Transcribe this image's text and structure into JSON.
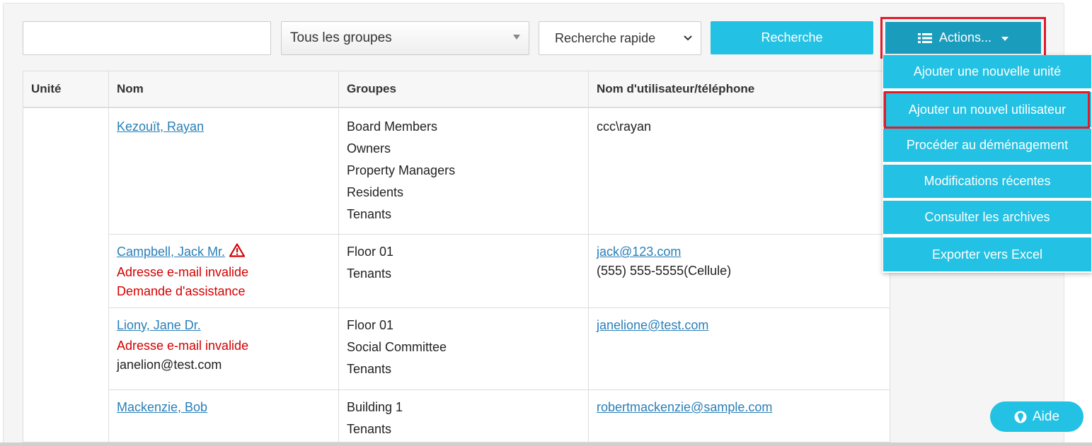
{
  "toolbar": {
    "search_value": "",
    "group_select": "Tous les groupes",
    "quick_select": "Recherche rapide",
    "search_button": "Recherche",
    "actions_button": "Actions..."
  },
  "actions_menu": {
    "items": [
      "Ajouter une nouvelle unité",
      "Ajouter un nouvel utilisateur",
      "Procéder au déménagement",
      "Modifications récentes",
      "Consulter les archives",
      "Exporter vers Excel"
    ],
    "highlighted_index": 1
  },
  "table": {
    "headers": [
      "Unité",
      "Nom",
      "Groupes",
      "Nom d'utilisateur/téléphone"
    ],
    "rows": [
      {
        "unit": "",
        "name": "Kezouït, Rayan",
        "name_notes": [],
        "name_extra": "",
        "warning": false,
        "groups": [
          "Board Members",
          "Owners",
          "Property Managers",
          "Residents",
          "Tenants"
        ],
        "contact_link": "",
        "contact_text": "ccc\\rayan"
      },
      {
        "unit": "",
        "name": "Campbell, Jack Mr.",
        "name_notes": [
          "Adresse e-mail invalide",
          "Demande d'assistance"
        ],
        "name_extra": "",
        "warning": true,
        "groups": [
          "Floor 01",
          "Tenants"
        ],
        "contact_link": "jack@123.com",
        "contact_text": "(555) 555-5555(Cellule)"
      },
      {
        "unit": "",
        "name": "Liony, Jane Dr.",
        "name_notes": [
          "Adresse e-mail invalide"
        ],
        "name_extra": "janelion@test.com",
        "warning": false,
        "groups": [
          "Floor 01",
          "Social Committee",
          "Tenants"
        ],
        "contact_link": "janelione@test.com",
        "contact_text": ""
      },
      {
        "unit": "",
        "name": "Mackenzie, Bob",
        "name_notes": [],
        "name_extra": "",
        "warning": false,
        "groups": [
          "Building 1",
          "Tenants"
        ],
        "contact_link": "robertmackenzie@sample.com",
        "contact_text": ""
      }
    ]
  },
  "help_button": "Aide",
  "colors": {
    "accent": "#23c1e3",
    "accent_dark": "#1a9cbd",
    "highlight_border": "#e21b2a",
    "link": "#2a7fb8",
    "error_text": "#d40000"
  }
}
